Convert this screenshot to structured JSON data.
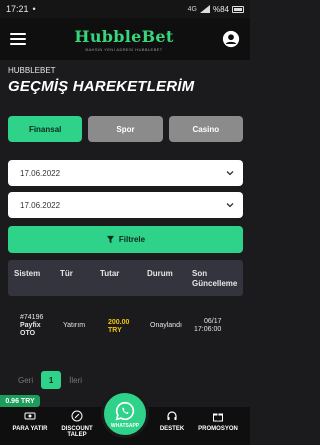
{
  "status_bar": {
    "time": "17:21",
    "signal": "4G",
    "battery": "%84"
  },
  "header": {
    "logo": "HubbleBet",
    "logo_tagline": "BAHSİN YENİ ADRESİ HUBBLEBET"
  },
  "page": {
    "brand": "HUBBLEBET",
    "title": "GEÇMİŞ HAREKETLERİM"
  },
  "tabs": [
    {
      "label": "Finansal",
      "active": true
    },
    {
      "label": "Spor",
      "active": false
    },
    {
      "label": "Casino",
      "active": false
    }
  ],
  "filters": {
    "start_date": "17.06.2022",
    "end_date": "17.06.2022",
    "filter_button": "Filtrele"
  },
  "table": {
    "headers": [
      "Sistem",
      "Tür",
      "Tutar",
      "Durum",
      "Son Güncelleme"
    ],
    "rows": [
      {
        "id": "#74196",
        "system": "Payfix OTO",
        "type": "Yatırım",
        "amount": "200.00",
        "currency": "TRY",
        "status": "Onaylandı",
        "date": "06/17",
        "time": "17:06:00"
      }
    ]
  },
  "pagination": {
    "prev": "Geri",
    "current": "1",
    "next": "İleri"
  },
  "balance": "0.96 TRY",
  "bottom_nav": {
    "deposit": "PARA YATIR",
    "discount": "DISCOUNT",
    "discount2": "TALEP",
    "whatsapp": "WHATSAPP",
    "support": "DESTEK",
    "promotion": "PROMOSYON"
  },
  "colors": {
    "accent": "#2ed389",
    "amount": "#f1c40f",
    "background": "#1b1b1d"
  }
}
